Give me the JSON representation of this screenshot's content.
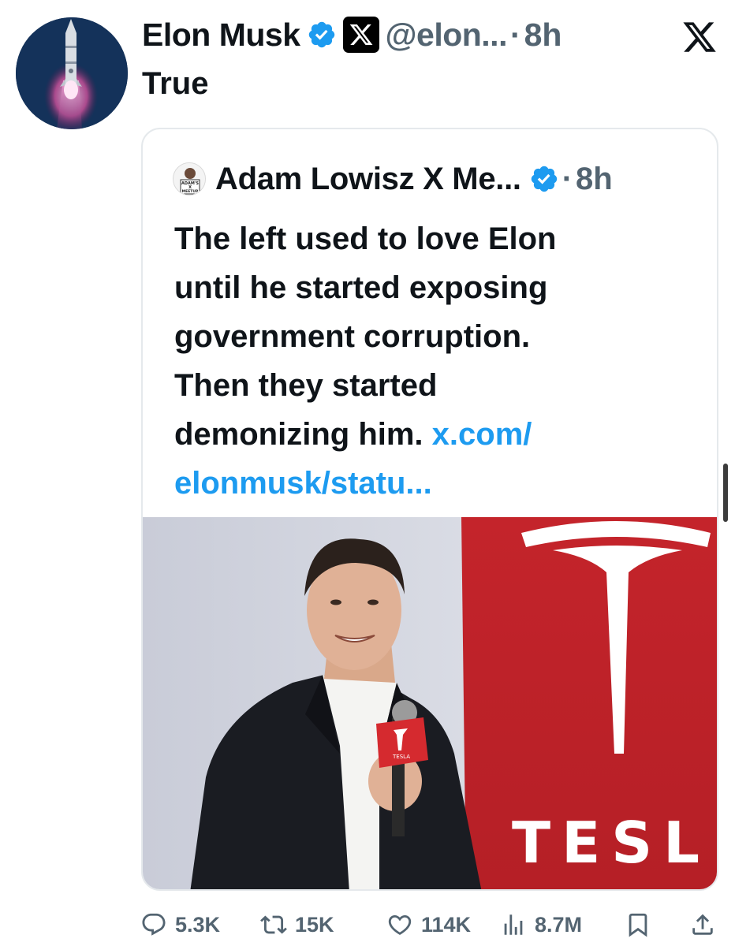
{
  "author": {
    "display_name": "Elon Musk",
    "handle": "@elon...",
    "separator": "·",
    "time": "8h"
  },
  "tweet": {
    "text": "True"
  },
  "quote": {
    "display_name": "Adam Lowisz X Me...",
    "separator": "·",
    "time": "8h",
    "avatar_text": [
      "ADAM'S",
      "X",
      "MEETUP"
    ],
    "body_lines": [
      "The left used to love Elon",
      "until he started exposing",
      "government corruption.",
      "Then they started",
      "demonizing him. "
    ],
    "link_part1": "x.com/",
    "link_part2": "elonmusk/statu...",
    "image_text": {
      "mic_brand": "TESLA",
      "banner_text": "TESL"
    }
  },
  "actions": {
    "replies": "5.3K",
    "reposts": "15K",
    "likes": "114K",
    "views": "8.7M"
  },
  "icons": {
    "verified": "verified-badge-icon",
    "affiliation": "x-logo-icon",
    "close": "x-logo-icon",
    "reply": "reply-icon",
    "repost": "repost-icon",
    "like": "heart-icon",
    "views": "views-icon",
    "bookmark": "bookmark-icon",
    "share": "share-icon"
  },
  "colors": {
    "accent": "#1d9bf0",
    "secondary_text": "#536471",
    "primary_text": "#0f1419",
    "tesla_red": "#c4242b"
  }
}
